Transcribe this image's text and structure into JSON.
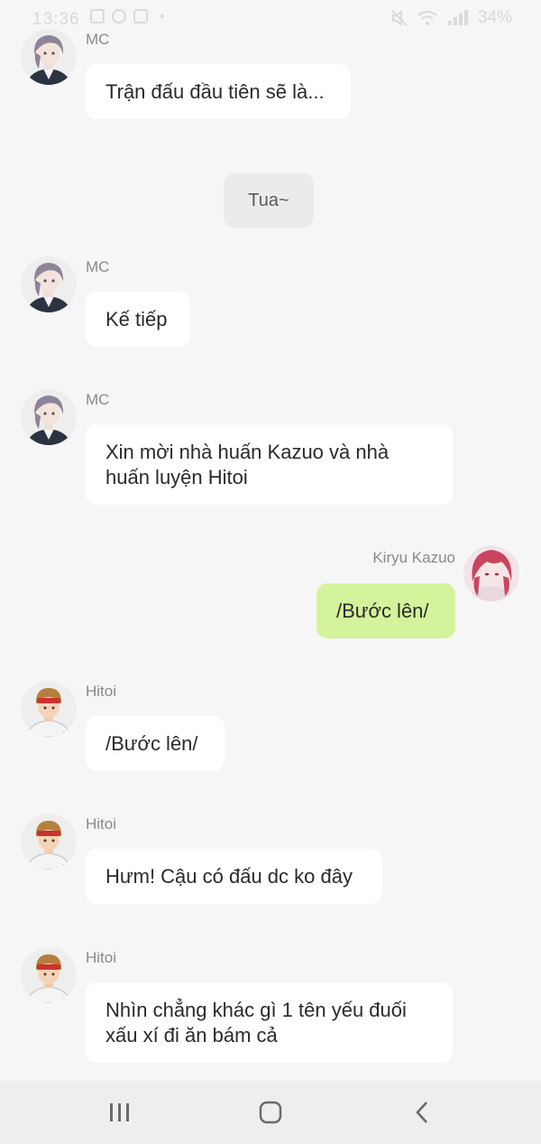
{
  "status_bar": {
    "time": "13:36",
    "battery": "34%",
    "left_icons": [
      "image-icon",
      "circle-minus-icon",
      "app-box-icon",
      "dot-icon"
    ],
    "right_icons": [
      "mute-icon",
      "wifi-icon",
      "signal-icon"
    ]
  },
  "messages": [
    {
      "kind": "npc",
      "sender": "MC",
      "text": "Trận đấu đầu tiên sẽ là...",
      "avatar": "mc-avatar"
    },
    {
      "kind": "narration",
      "text": "Tua~"
    },
    {
      "kind": "npc",
      "sender": "MC",
      "text": "Kế tiếp",
      "avatar": "mc-avatar"
    },
    {
      "kind": "npc",
      "sender": "MC",
      "lines": [
        "Xin mời nhà huấn Kazuo và nhà",
        "huấn luyện Hitoi"
      ],
      "avatar": "mc-avatar"
    },
    {
      "kind": "user",
      "sender": "Kiryu Kazuo",
      "text": "/Bước lên/",
      "avatar": "kazuo-avatar"
    },
    {
      "kind": "npc",
      "sender": "Hitoi",
      "text": "/Bước lên/",
      "avatar": "hitoi-avatar"
    },
    {
      "kind": "npc",
      "sender": "Hitoi",
      "text": "Hưm! Cậu có đấu dc ko đây",
      "avatar": "hitoi-avatar"
    },
    {
      "kind": "npc",
      "sender": "Hitoi",
      "lines": [
        "Nhìn chẳng khác gì 1 tên yếu đuối",
        "xấu xí đi ăn bám cả"
      ],
      "avatar": "hitoi-avatar"
    }
  ],
  "nav_bar": {
    "buttons": [
      "recent-apps-icon",
      "home-icon",
      "back-icon"
    ]
  },
  "colors": {
    "background": "#f6f6f6",
    "bubble": "#ffffff",
    "user_bubble": "#d5f39a",
    "narration_bubble": "#ebebeb",
    "sender_text": "#8a8a8a",
    "nav_bar": "#eeeeee"
  }
}
